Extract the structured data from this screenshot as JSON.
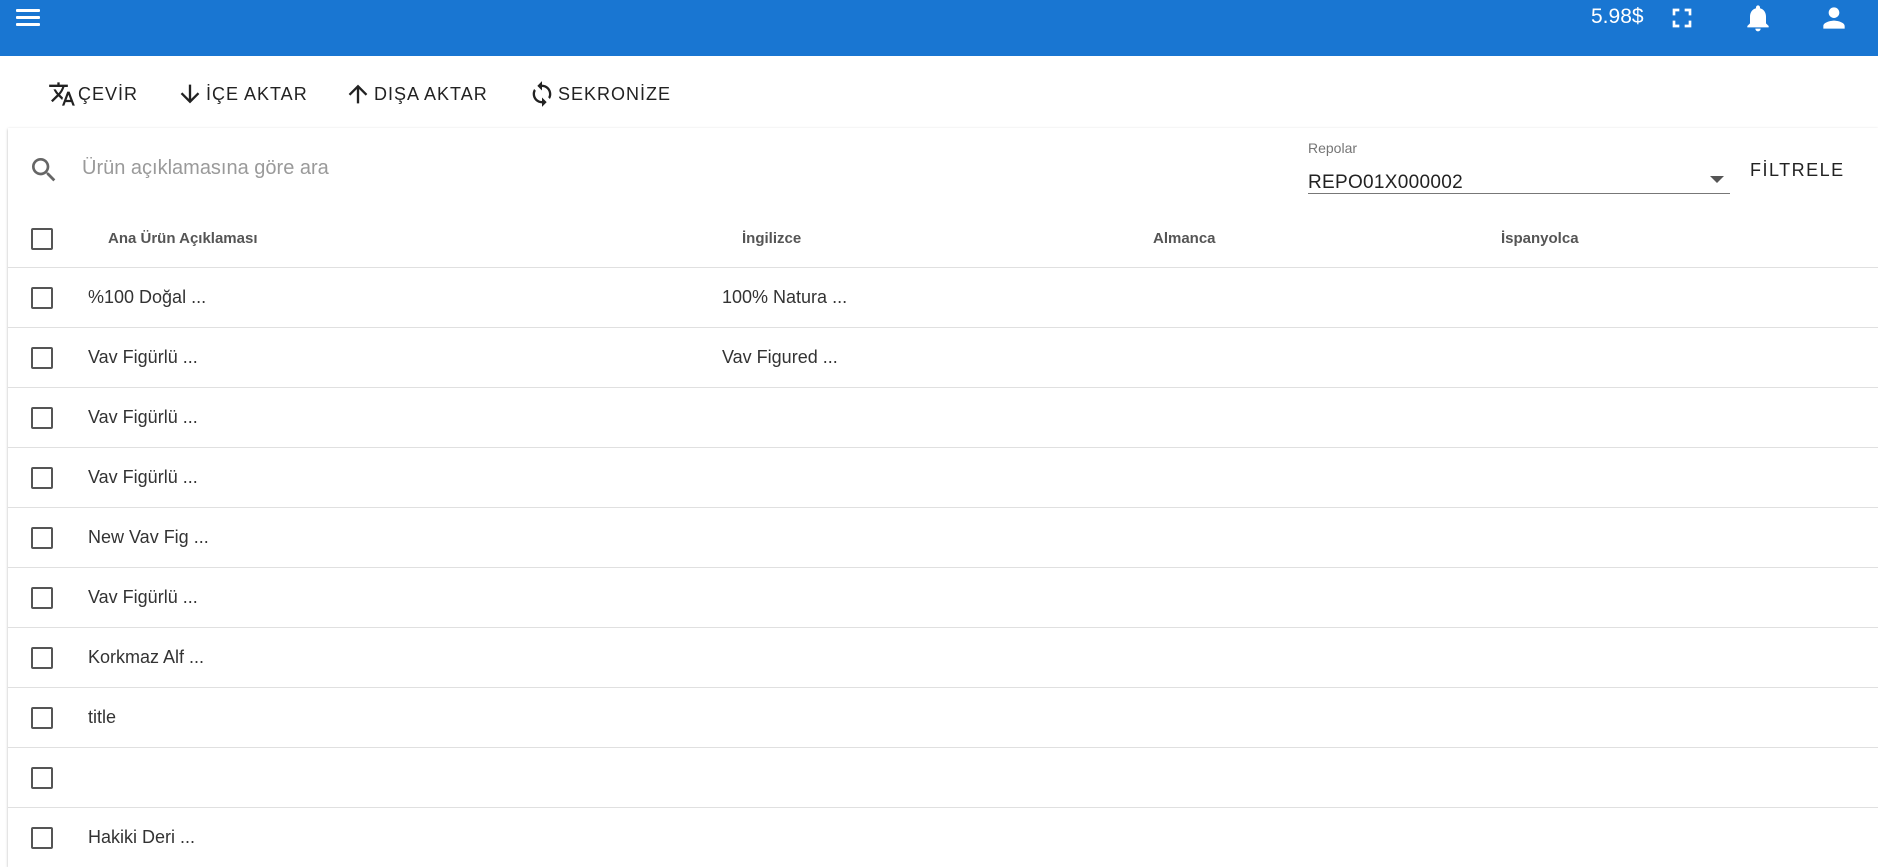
{
  "appbar": {
    "balance": "5.98$",
    "icons": [
      "menu-icon",
      "fullscreen-icon",
      "bell-icon",
      "account-icon"
    ],
    "color": "#1976d2"
  },
  "toolbar": {
    "translate_label": "ÇEVİR",
    "import_label": "İÇE AKTAR",
    "export_label": "DIŞA AKTAR",
    "sync_label": "SEKRONİZE"
  },
  "search": {
    "placeholder": "Ürün açıklamasına göre ara",
    "value": ""
  },
  "repo_select": {
    "label": "Repolar",
    "value": "REPO01X000002"
  },
  "filter_label": "FİLTRELE",
  "table": {
    "headers": [
      "Ana Ürün Açıklaması",
      "İngilizce",
      "Almanca",
      "İspanyolca"
    ],
    "rows": [
      [
        "%100 Doğal ...",
        "100% Natura ...",
        "",
        ""
      ],
      [
        "Vav Figürlü ...",
        "Vav Figured ...",
        "",
        ""
      ],
      [
        "Vav Figürlü ...",
        "",
        "",
        ""
      ],
      [
        "Vav Figürlü ...",
        "",
        "",
        ""
      ],
      [
        "New Vav Fig ...",
        "",
        "",
        ""
      ],
      [
        "Vav Figürlü ...",
        "",
        "",
        ""
      ],
      [
        "Korkmaz Alf ...",
        "",
        "",
        ""
      ],
      [
        "title",
        "",
        "",
        ""
      ],
      [
        "",
        "",
        "",
        ""
      ],
      [
        "Hakiki Deri ...",
        "",
        "",
        ""
      ]
    ]
  }
}
